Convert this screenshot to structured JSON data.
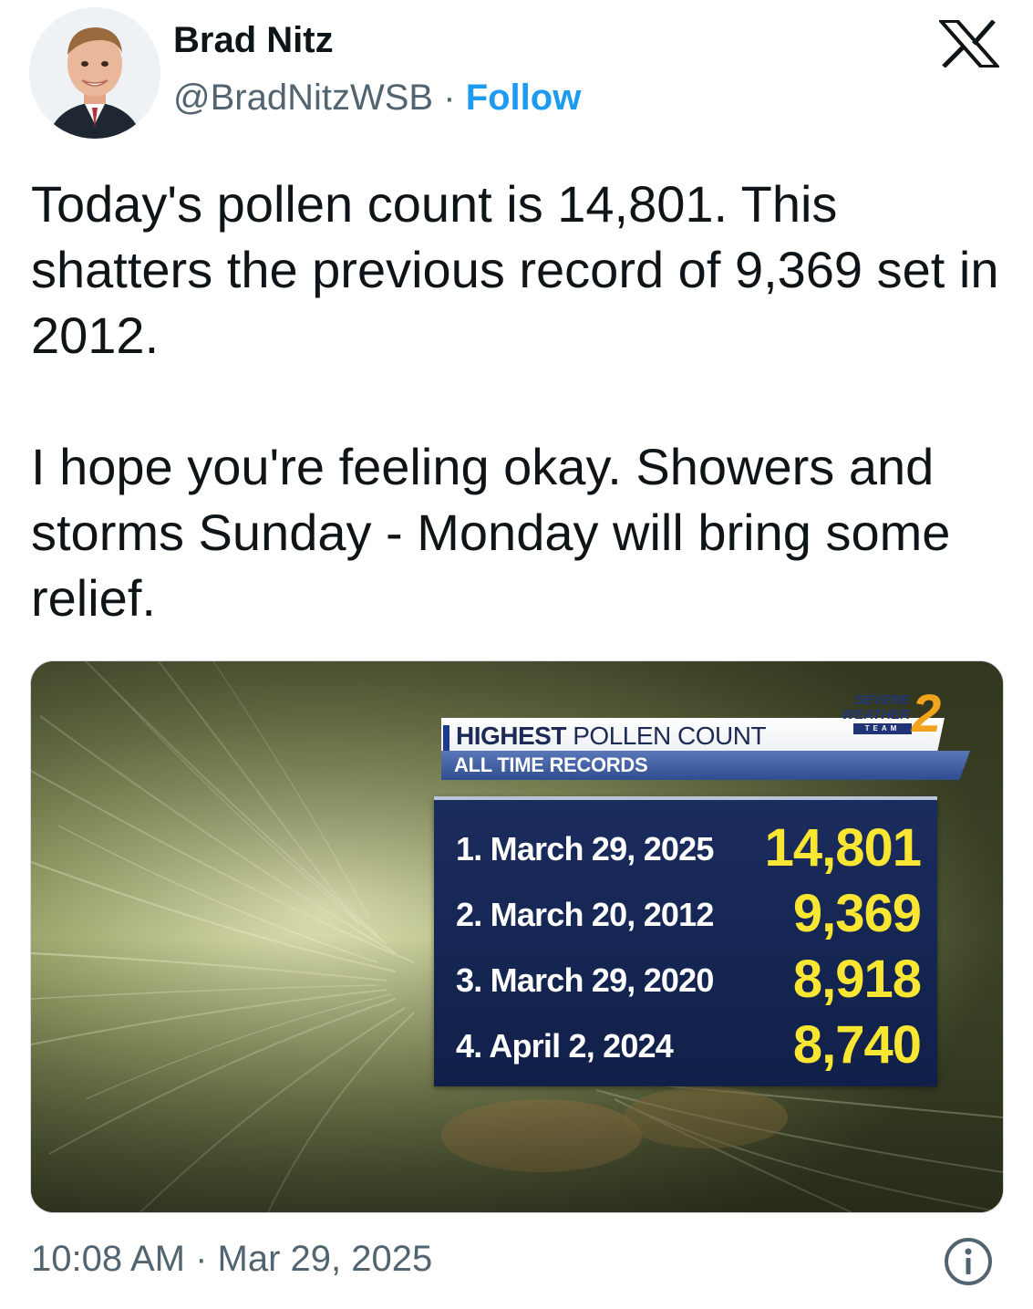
{
  "author": {
    "name": "Brad Nitz",
    "handle": "@BradNitzWSB",
    "separator": "·",
    "follow_label": "Follow"
  },
  "tweet": {
    "paragraphs": [
      "Today's pollen count is 14,801. This shatters the previous record of 9,369 set in 2012.",
      "I hope you're feeling okay. Showers and storms Sunday - Monday will bring some relief."
    ],
    "timestamp": "10:08 AM · Mar 29, 2025"
  },
  "media": {
    "graphic": {
      "title_bold": "HIGHEST",
      "title_rest": " POLLEN COUNT",
      "subtitle": "ALL TIME RECORDS",
      "logo": {
        "line1": "SEVERE",
        "line2": "WEATHER",
        "line3": "TEAM",
        "number": "2"
      },
      "records": [
        {
          "label": "1. March 29, 2025",
          "value": "14,801"
        },
        {
          "label": "2. March 20, 2012",
          "value": "9,369"
        },
        {
          "label": "3. March 29, 2020",
          "value": "8,918"
        },
        {
          "label": "4. April 2, 2024",
          "value": "8,740"
        }
      ]
    }
  },
  "icons": {
    "brand": "x-logo-icon",
    "info": "info-icon"
  },
  "colors": {
    "follow": "#1d9bf0",
    "secondary_text": "#536471",
    "record_value": "#f8e633",
    "panel": "#142453"
  }
}
